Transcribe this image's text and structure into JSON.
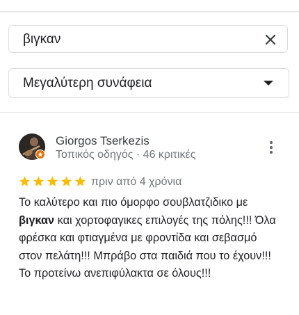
{
  "search": {
    "value": "βιγκαν",
    "clear_icon": "close-icon"
  },
  "sort": {
    "selected": "Μεγαλύτερη συνάφεια",
    "arrow_icon": "dropdown-arrow-icon"
  },
  "review": {
    "author": "Giorgos Tserkezis",
    "author_meta": "Τοπικός οδηγός · 46 κριτικές",
    "rating": 5,
    "rating_max": 5,
    "star_color": "#fbbc04",
    "date": "πριν από 4 χρόνια",
    "text_before": "Το καλύτερο και πιο όμορφο σουβλατζιδικο με ",
    "text_highlight": "βιγκαν",
    "text_after": " και χορτοφαγικες επιλογές της πόλης!!! Όλα φρέσκα και φτιαγμένα με φροντίδα και σεβασμό στον πελάτη!!! Μπράβο στα παιδιά που το έχουν!!! Το προτείνω ανεπιφύλακτα σε όλους!!!"
  },
  "colors": {
    "local_guide_badge": "#e8710a",
    "border": "#dadce0",
    "secondary_text": "#70757a"
  }
}
